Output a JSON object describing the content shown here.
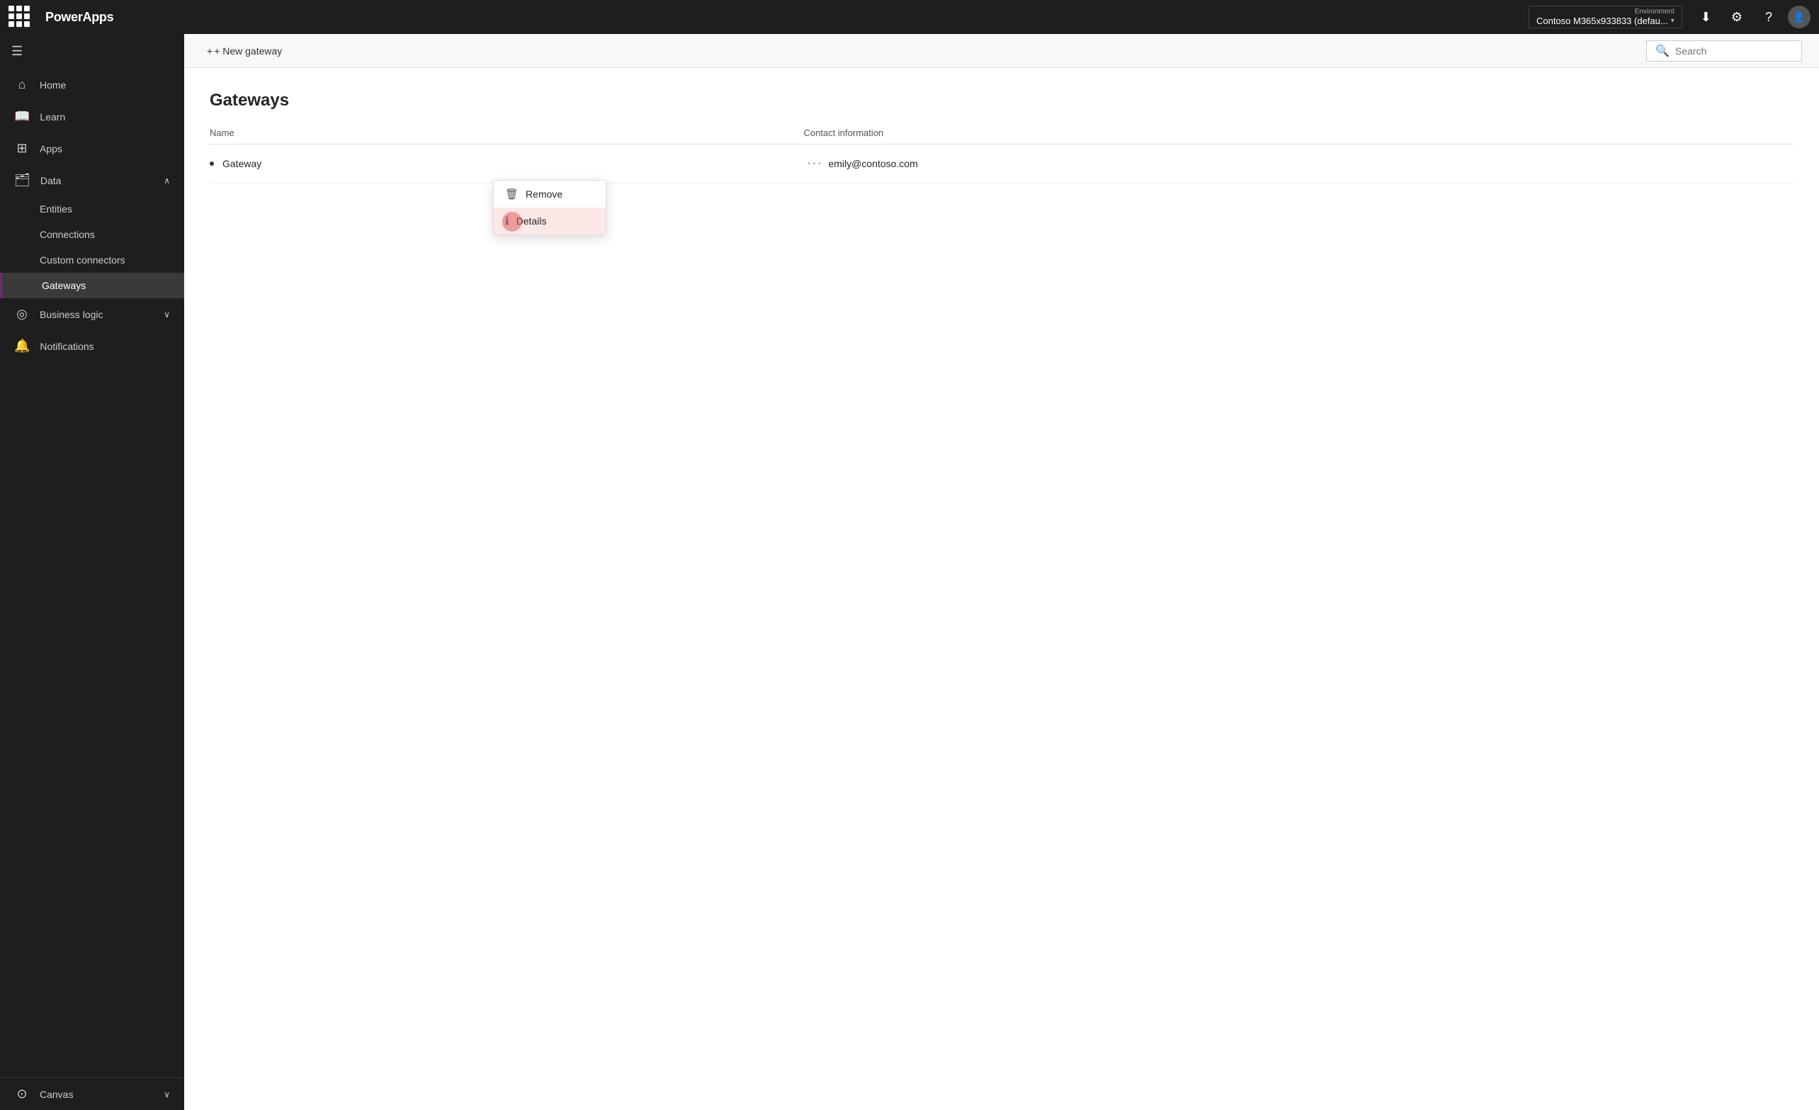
{
  "topbar": {
    "title": "PowerApps",
    "environment_label": "Environment",
    "environment_value": "Contoso M365x933833 (defau...",
    "search_placeholder": "Search"
  },
  "sidebar": {
    "collapse_icon": "☰",
    "items": [
      {
        "id": "home",
        "label": "Home",
        "icon": "⌂",
        "active": false
      },
      {
        "id": "learn",
        "label": "Learn",
        "icon": "□",
        "active": false
      },
      {
        "id": "apps",
        "label": "Apps",
        "icon": "⊞",
        "active": false
      },
      {
        "id": "data",
        "label": "Data",
        "icon": "⊟",
        "active": false,
        "expanded": true
      },
      {
        "id": "entities",
        "label": "Entities",
        "sub": true,
        "active": false
      },
      {
        "id": "connections",
        "label": "Connections",
        "sub": true,
        "active": false
      },
      {
        "id": "custom-connectors",
        "label": "Custom connectors",
        "sub": true,
        "active": false
      },
      {
        "id": "gateways",
        "label": "Gateways",
        "sub": true,
        "active": true
      },
      {
        "id": "business-logic",
        "label": "Business logic",
        "icon": "◎",
        "active": false,
        "expandable": true
      },
      {
        "id": "notifications",
        "label": "Notifications",
        "icon": "🔔",
        "active": false
      }
    ],
    "bottom": {
      "canvas_label": "Canvas",
      "canvas_icon": "⊙"
    }
  },
  "toolbar": {
    "new_gateway_label": "+ New gateway"
  },
  "page": {
    "title": "Gateways",
    "table": {
      "col_name": "Name",
      "col_contact": "Contact information",
      "rows": [
        {
          "name": "Gateway",
          "contact": "emily@contoso.com"
        }
      ]
    }
  },
  "context_menu": {
    "items": [
      {
        "id": "remove",
        "label": "Remove",
        "icon": "🗑"
      },
      {
        "id": "details",
        "label": "Details",
        "icon": "ℹ"
      }
    ]
  }
}
